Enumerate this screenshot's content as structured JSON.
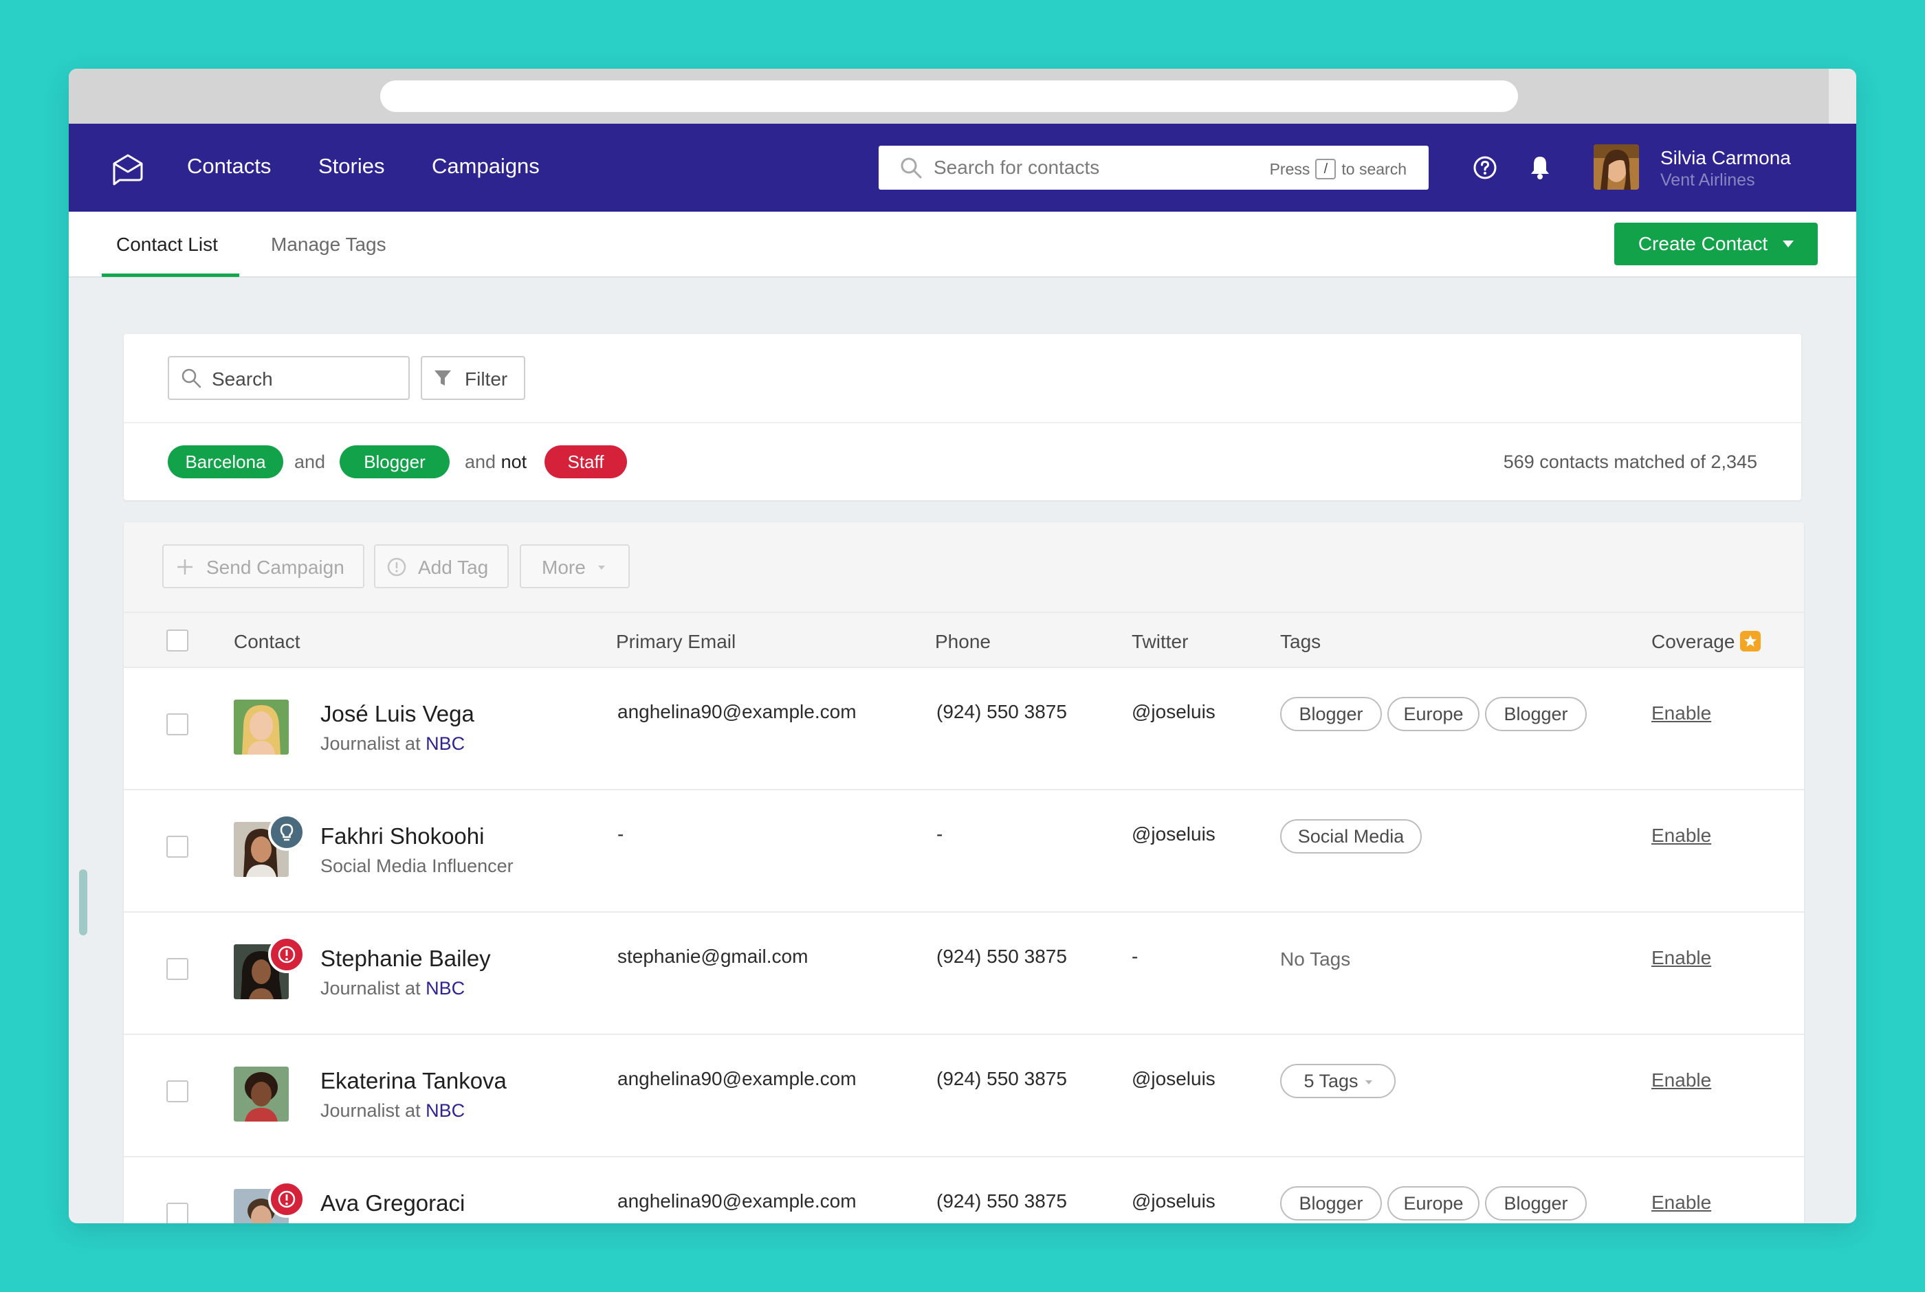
{
  "nav": {
    "links": [
      "Contacts",
      "Stories",
      "Campaigns"
    ],
    "search_placeholder": "Search for contacts",
    "search_hint_prefix": "Press",
    "search_hint_key": "/",
    "search_hint_suffix": "to search",
    "user_name": "Silvia Carmona",
    "user_company": "Vent Airlines"
  },
  "subnav": {
    "tabs": [
      {
        "label": "Contact List",
        "active": true
      },
      {
        "label": "Manage Tags",
        "active": false
      }
    ],
    "create_label": "Create Contact"
  },
  "filters": {
    "search_placeholder": "Search",
    "filter_label": "Filter",
    "chips": [
      {
        "label": "Barcelona",
        "color": "#12a24a"
      },
      {
        "label": "Blogger",
        "color": "#12a24a"
      },
      {
        "label": "Staff",
        "color": "#d6213a"
      }
    ],
    "conj_and": "and",
    "conj_and2": "and",
    "conj_not": "not",
    "match_text": "569 contacts matched of 2,345"
  },
  "toolbar": {
    "send_campaign": "Send Campaign",
    "add_tag": "Add Tag",
    "more": "More"
  },
  "table": {
    "columns": [
      "Contact",
      "Primary Email",
      "Phone",
      "Twitter",
      "Tags",
      "Coverage"
    ],
    "rows": [
      {
        "name": "José Luis Vega",
        "role_prefix": "Journalist at",
        "org": "NBC",
        "email": "anghelina90@example.com",
        "phone": "(924) 550 3875",
        "twitter": "@joseluis",
        "tags": [
          "Blogger",
          "Europe",
          "Blogger"
        ],
        "coverage": "Enable"
      },
      {
        "name": "Fakhri Shokoohi",
        "role_prefix": "Social Media Influencer",
        "org": "",
        "email": "-",
        "phone": "-",
        "twitter": "@joseluis",
        "tags": [
          "Social Media"
        ],
        "coverage": "Enable",
        "badge": "lightbulb"
      },
      {
        "name": "Stephanie Bailey",
        "role_prefix": "Journalist at",
        "org": "NBC",
        "email": "stephanie@gmail.com",
        "phone": "(924) 550 3875",
        "twitter": "-",
        "tags_text": "No Tags",
        "coverage": "Enable",
        "badge": "alert"
      },
      {
        "name": "Ekaterina Tankova",
        "role_prefix": "Journalist at",
        "org": "NBC",
        "email": "anghelina90@example.com",
        "phone": "(924) 550 3875",
        "twitter": "@joseluis",
        "tags_dropdown": "5 Tags",
        "coverage": "Enable"
      },
      {
        "name": "Ava Gregoraci",
        "email": "anghelina90@example.com",
        "phone": "(924) 550 3875",
        "twitter": "@joseluis",
        "tags": [
          "Blogger",
          "Europe",
          "Blogger"
        ],
        "coverage": "Enable",
        "badge": "alert"
      }
    ]
  },
  "colors": {
    "nav_bg": "#2e2490",
    "accent_green": "#12a24a",
    "danger_red": "#d6213a",
    "background": "#2acfc6",
    "coverage_star": "#f5a524"
  }
}
